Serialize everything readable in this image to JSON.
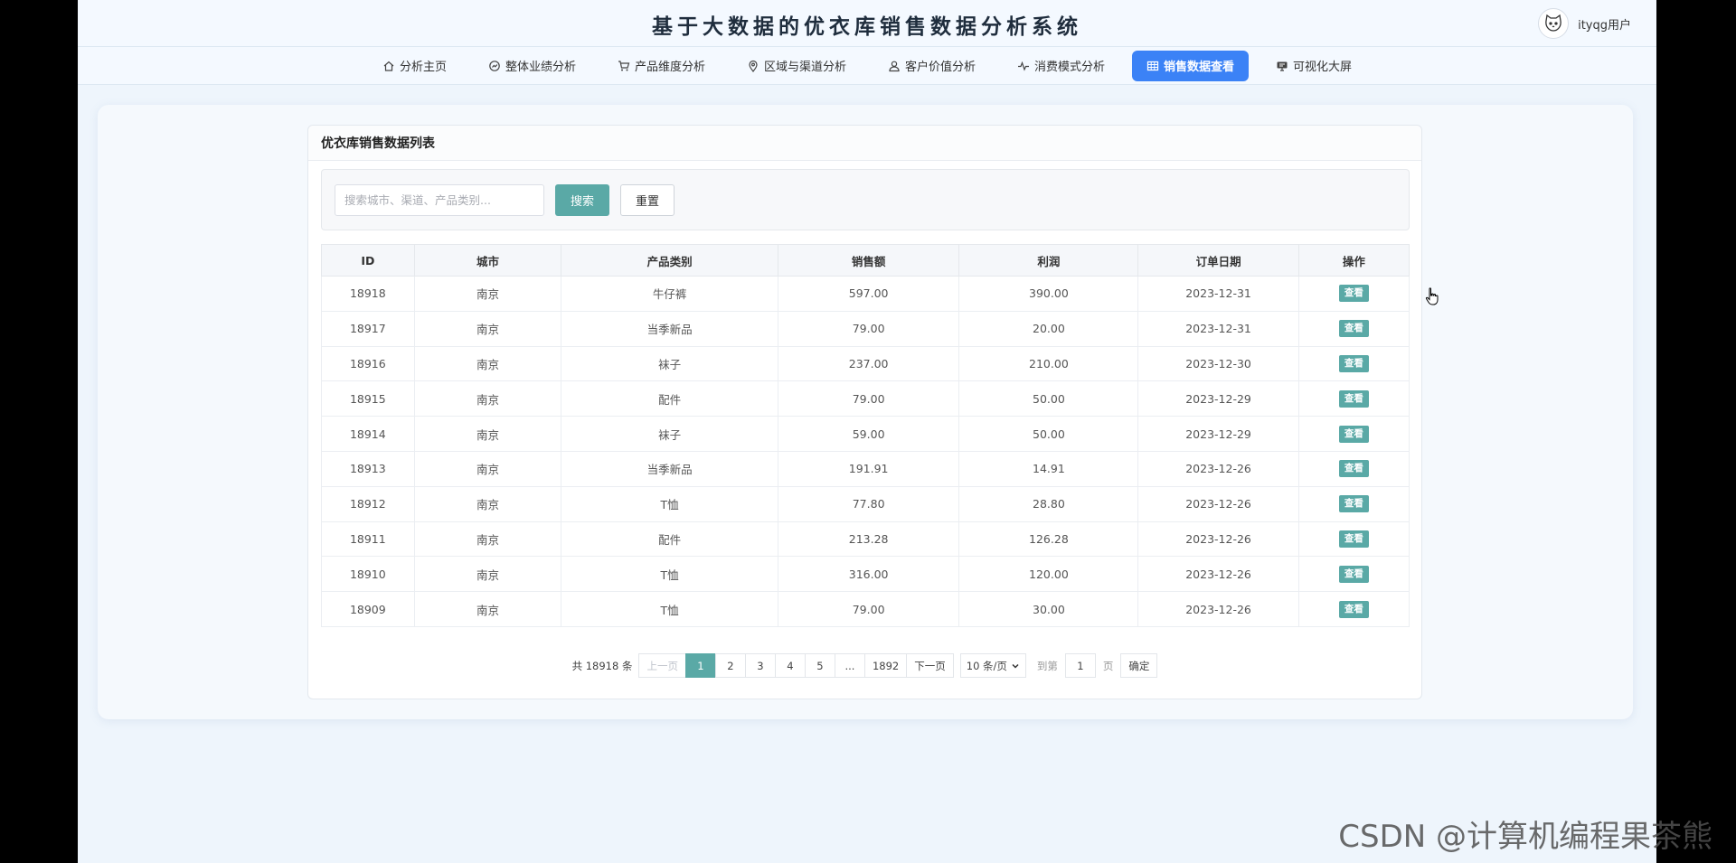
{
  "header": {
    "title": "基于大数据的优衣库销售数据分析系统",
    "username": "ityqg用户"
  },
  "nav": [
    {
      "label": "分析主页",
      "icon": "home-icon",
      "active": false
    },
    {
      "label": "整体业绩分析",
      "icon": "chart-icon",
      "active": false
    },
    {
      "label": "产品维度分析",
      "icon": "cart-icon",
      "active": false
    },
    {
      "label": "区域与渠道分析",
      "icon": "location-icon",
      "active": false
    },
    {
      "label": "客户价值分析",
      "icon": "user-icon",
      "active": false
    },
    {
      "label": "消费模式分析",
      "icon": "pulse-icon",
      "active": false
    },
    {
      "label": "销售数据查看",
      "icon": "grid-icon",
      "active": true
    },
    {
      "label": "可视化大屏",
      "icon": "screen-icon",
      "active": false
    }
  ],
  "card": {
    "title": "优衣库销售数据列表"
  },
  "filter": {
    "placeholder": "搜索城市、渠道、产品类别...",
    "search_label": "搜索",
    "reset_label": "重置"
  },
  "table": {
    "columns": [
      "ID",
      "城市",
      "产品类别",
      "销售额",
      "利润",
      "订单日期",
      "操作"
    ],
    "action_label": "查看",
    "rows": [
      [
        "18918",
        "南京",
        "牛仔裤",
        "597.00",
        "390.00",
        "2023-12-31"
      ],
      [
        "18917",
        "南京",
        "当季新品",
        "79.00",
        "20.00",
        "2023-12-31"
      ],
      [
        "18916",
        "南京",
        "袜子",
        "237.00",
        "210.00",
        "2023-12-30"
      ],
      [
        "18915",
        "南京",
        "配件",
        "79.00",
        "50.00",
        "2023-12-29"
      ],
      [
        "18914",
        "南京",
        "袜子",
        "59.00",
        "50.00",
        "2023-12-29"
      ],
      [
        "18913",
        "南京",
        "当季新品",
        "191.91",
        "14.91",
        "2023-12-26"
      ],
      [
        "18912",
        "南京",
        "T恤",
        "77.80",
        "28.80",
        "2023-12-26"
      ],
      [
        "18911",
        "南京",
        "配件",
        "213.28",
        "126.28",
        "2023-12-26"
      ],
      [
        "18910",
        "南京",
        "T恤",
        "316.00",
        "120.00",
        "2023-12-26"
      ],
      [
        "18909",
        "南京",
        "T恤",
        "79.00",
        "30.00",
        "2023-12-26"
      ]
    ]
  },
  "pagination": {
    "total_text": "共 18918 条",
    "prev": "上一页",
    "pages": [
      "1",
      "2",
      "3",
      "4",
      "5",
      "...",
      "1892"
    ],
    "current": "1",
    "next": "下一页",
    "page_size": "10 条/页",
    "goto_label": "到第",
    "goto_value": "1",
    "goto_unit": "页",
    "confirm": "确定"
  },
  "watermark": "CSDN @计算机编程果茶熊",
  "colors": {
    "accent": "#5aa9a6",
    "nav_active": "#3b82f6"
  }
}
